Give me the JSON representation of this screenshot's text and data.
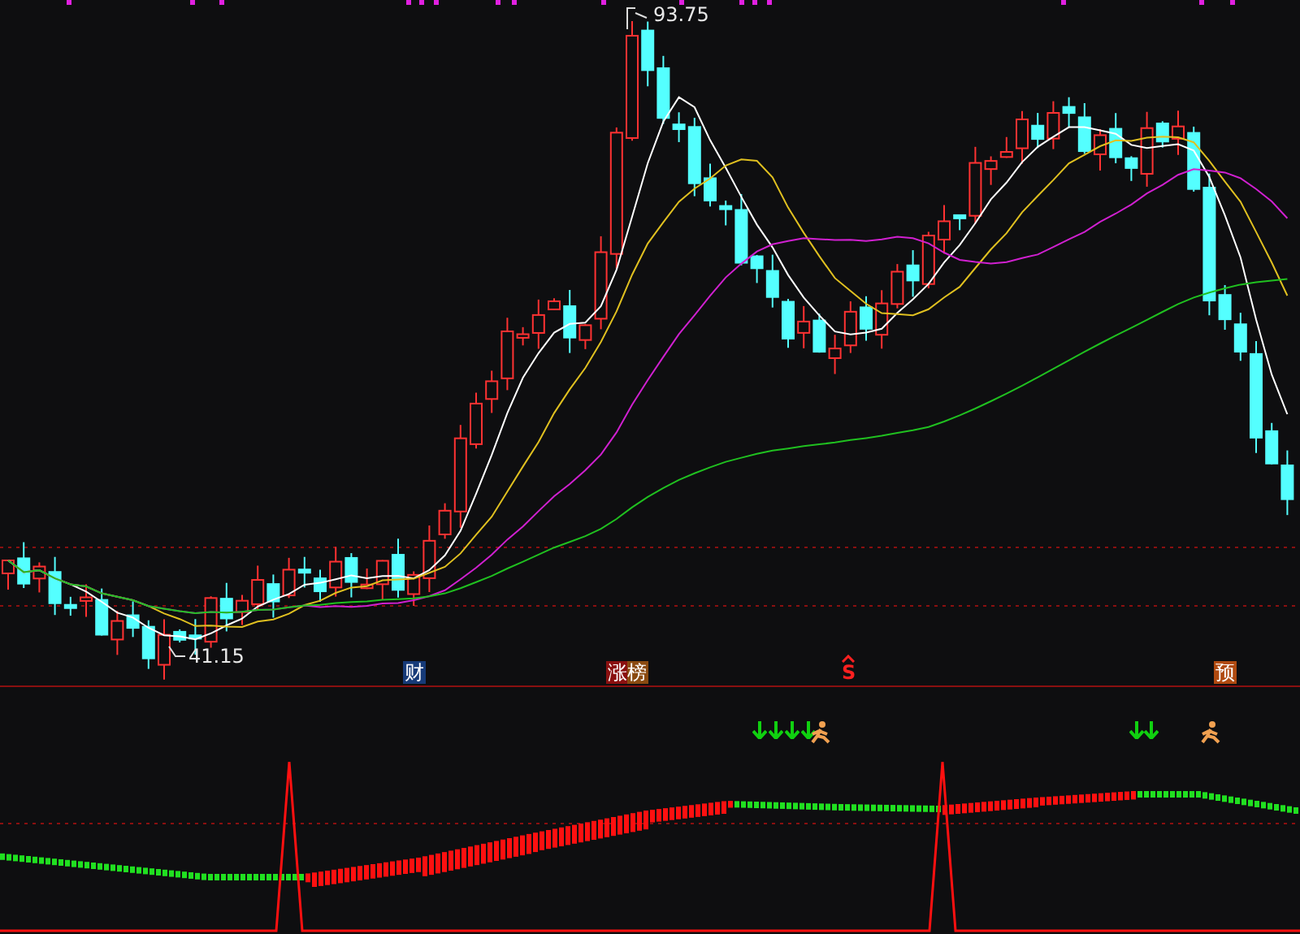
{
  "main_chart": {
    "high_label": "93.75",
    "low_label": "41.15"
  },
  "event_badges": [
    {
      "kind": "fund",
      "text": "财"
    },
    {
      "kind": "limit-up",
      "text": "涨榜"
    },
    {
      "kind": "sell",
      "text": "S"
    },
    {
      "kind": "forecast",
      "text": "预"
    }
  ],
  "indicator_panel": {
    "signals": [
      {
        "kind": "down-arrow"
      },
      {
        "kind": "down-arrow"
      },
      {
        "kind": "down-arrow"
      },
      {
        "kind": "down-arrow"
      },
      {
        "kind": "runner"
      },
      {
        "kind": "down-arrow"
      },
      {
        "kind": "down-arrow"
      },
      {
        "kind": "runner"
      }
    ]
  }
}
